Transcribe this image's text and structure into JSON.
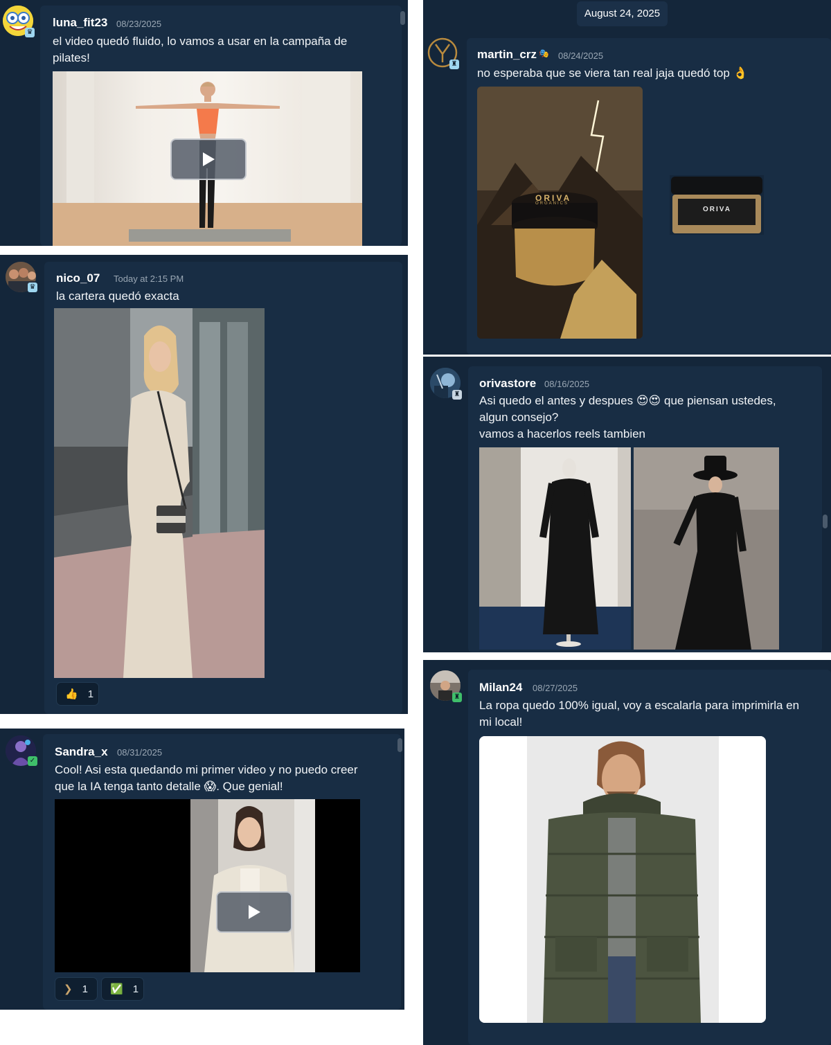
{
  "posts": [
    {
      "username": "luna_fit23",
      "timestamp": "08/23/2025",
      "message": "el video quedó fluido, lo vamos a usar en la campaña de pilates!",
      "media": "video"
    },
    {
      "username": "nico_07",
      "timestamp": "Today at 2:15 PM",
      "message": "la cartera quedó exacta",
      "media": "image",
      "reactions": [
        {
          "emoji": "👍",
          "count": "1"
        }
      ]
    },
    {
      "username": "Sandra_x",
      "timestamp": "08/31/2025",
      "message": "Cool! Asi esta quedando mi primer video y no puedo creer que la IA tenga tanto detalle 😱. Que genial!",
      "media": "video",
      "reactions": [
        {
          "emoji": "❯",
          "count": "1"
        },
        {
          "emoji": "✅",
          "count": "1"
        }
      ]
    },
    {
      "date_divider": "August 24, 2025",
      "username": "martin_crz",
      "timestamp": "08/24/2025",
      "message": "no esperaba que se viera tan real jaja quedó top 👌",
      "media": "images",
      "labels": {
        "jar_brand": "ORIVA",
        "jar_sub": "ORGANICS"
      }
    },
    {
      "username": "orivastore",
      "timestamp": "08/16/2025",
      "message": "Asi quedo el antes y despues 😍😍 que piensan ustedes, algun consejo?",
      "message_line2": "vamos a hacerlos reels tambien",
      "media": "images"
    },
    {
      "username": "Milan24",
      "timestamp": "08/27/2025",
      "message": "La ropa quedo 100% igual, voy a escalarla para imprimirla en mi local!",
      "media": "image"
    }
  ],
  "colors": {
    "panel_bg": "#14263a",
    "card_bg": "#182d44",
    "text": "#f1f4f7",
    "muted": "#9aa7b4"
  }
}
